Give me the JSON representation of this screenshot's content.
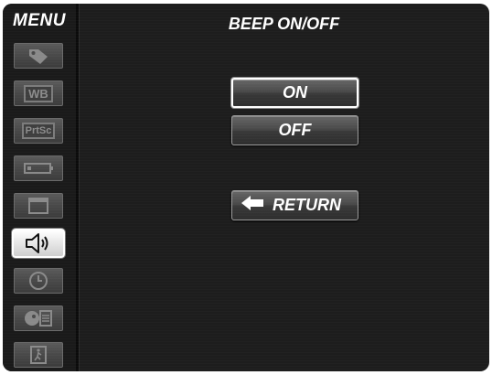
{
  "menu": {
    "title": "MENU",
    "items": [
      {
        "icon": "tag-icon",
        "active": false
      },
      {
        "icon": "white-balance-icon",
        "label": "WB",
        "active": false
      },
      {
        "icon": "print-screen-icon",
        "label": "PrtSc",
        "active": false
      },
      {
        "icon": "battery-icon",
        "active": false
      },
      {
        "icon": "screen-icon",
        "active": false
      },
      {
        "icon": "speaker-icon",
        "active": true
      },
      {
        "icon": "clock-icon",
        "active": false
      },
      {
        "icon": "language-icon",
        "active": false
      },
      {
        "icon": "exit-icon",
        "active": false
      }
    ]
  },
  "screen": {
    "title": "BEEP ON/OFF",
    "options": [
      {
        "label": "ON",
        "selected": true
      },
      {
        "label": "OFF",
        "selected": false
      }
    ],
    "return_label": "RETURN",
    "return_icon": "arrow-left-icon"
  }
}
